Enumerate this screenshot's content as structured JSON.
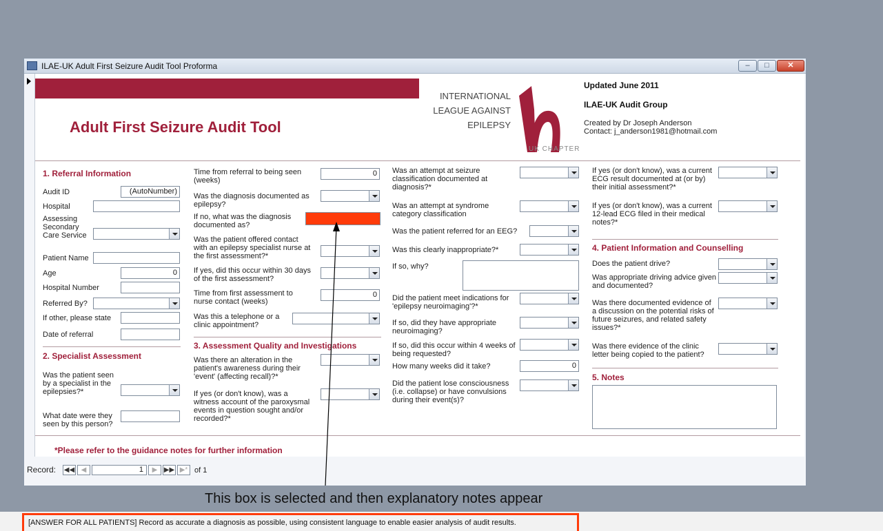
{
  "window": {
    "title": "ILAE-UK Adult First Seizure Audit Tool Proforma"
  },
  "header": {
    "app_title": "Adult First Seizure Audit Tool",
    "logo_line1": "INTERNATIONAL",
    "logo_line2": "LEAGUE AGAINST",
    "logo_line3": "EPILEPSY",
    "logo_sub": "UK CHAPTER",
    "updated": "Updated June 2011",
    "group": "ILAE-UK Audit Group",
    "created_by": "Created by Dr Joseph Anderson",
    "contact": "Contact: j_anderson1981@hotmail.com"
  },
  "sec1": {
    "title": "1. Referral Information",
    "audit_id_label": "Audit ID",
    "audit_id_value": "(AutoNumber)",
    "hospital_label": "Hospital",
    "service_label": "Assessing Secondary Care Service",
    "patient_name_label": "Patient Name",
    "age_label": "Age",
    "age_value": "0",
    "hospital_number_label": "Hospital Number",
    "referred_by_label": "Referred By?",
    "if_other_label": "If other, please state",
    "date_referral_label": "Date of referral"
  },
  "sec2": {
    "title": "2. Specialist Assessment",
    "seen_specialist_label": "Was the patient seen by a specialist in the epilepsies?*",
    "date_seen_label": "What date were they seen by this person?"
  },
  "col2": {
    "time_referral_label": "Time from referral to being seen (weeks)",
    "time_referral_value": "0",
    "diagnosis_epilepsy_label": "Was the diagnosis documented as epilepsy?",
    "diagnosis_documented_label": "If no, what was the diagnosis documented as?",
    "nurse_contact_label": "Was the patient offered contact with an epilepsy specialist nurse at the first assessment?*",
    "within30_label": "If yes, did this occur within 30 days of the first assessment?",
    "time_nurse_label": "Time from first assessment to nurse contact (weeks)",
    "time_nurse_value": "0",
    "phone_clinic_label": "Was this a telephone or a clinic appointment?"
  },
  "sec3": {
    "title": "3. Assessment Quality and Investigations",
    "awareness_label": "Was there an alteration in the patient's awareness during their 'event' (affecting recall)?*",
    "witness_label": "If yes (or don't know), was a witness account of the paroxysmal events in question sought and/or recorded?*"
  },
  "col3": {
    "seizure_class_label": "Was an attempt at seizure classification documented at diagnosis?*",
    "syndrome_class_label": "Was an attempt at syndrome category classification",
    "eeg_label": "Was the patient referred for an EEG?",
    "inappropriate_label": "Was this clearly inappropriate?*",
    "why_label": "If so, why?",
    "neuroimaging_label": "Did the patient meet indications for 'epilepsy neuroimaging'?*",
    "appropriate_imaging_label": "If so, did they have appropriate neuroimaging?",
    "within4_label": "If so, did this occur within 4 weeks of being requested?",
    "weeks_label": "How many weeks did it take?",
    "weeks_value": "0",
    "consciousness_label": "Did the patient lose consciousness (i.e. collapse) or have convulsions during their event(s)?"
  },
  "col4": {
    "ecg_result_label": "If yes (or don't know), was a current ECG result documented at (or by) their initial assessment?*",
    "ecg_filed_label": "If yes (or don't know), was a current 12-lead ECG filed in their medical notes?*",
    "sec4_title": "4. Patient Information and Counselling",
    "drive_label": "Does the patient drive?",
    "driving_advice_label": "Was appropriate driving advice given and documented?",
    "risks_label": "Was there documented evidence of a discussion on the potential risks of future seizures, and related safety issues?*",
    "letter_label": "Was there evidence of the clinic letter being copied to the patient?",
    "sec5_title": "5. Notes"
  },
  "guidance": "*Please refer to the guidance notes for further information",
  "nav": {
    "record_label": "Record:",
    "current": "1",
    "of_label": "of 1"
  },
  "annotation": "This box is selected and then explanatory notes appear",
  "status_message": "[ANSWER FOR ALL PATIENTS] Record as accurate a diagnosis as possible, using consistent language to enable easier analysis of audit results.",
  "colors": {
    "brand": "#a0203b",
    "highlight": "#ff3b0a"
  }
}
